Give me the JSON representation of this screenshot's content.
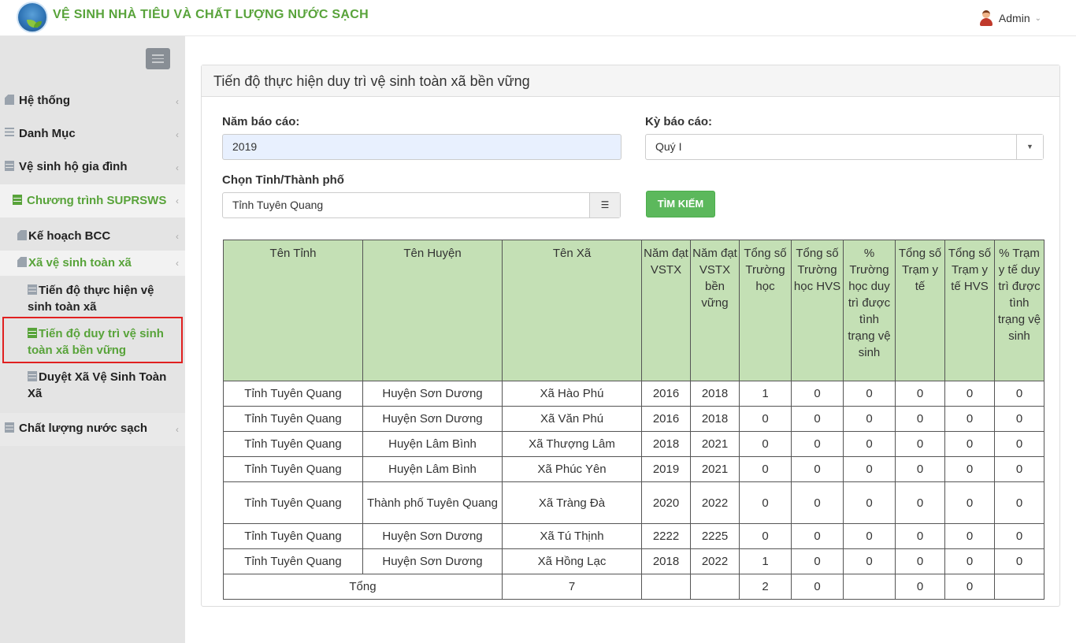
{
  "header": {
    "title": "VỆ SINH NHÀ TIÊU VÀ CHẤT LƯỢNG NƯỚC SẠCH",
    "user": "Admin"
  },
  "sidebar": {
    "items": [
      {
        "label": "Hệ thống",
        "icon": "file-icon"
      },
      {
        "label": "Danh Mục",
        "icon": "list-icon"
      },
      {
        "label": "Vệ sinh hộ gia đình",
        "icon": "table-icon"
      },
      {
        "label": "Chương trình SUPRSWS",
        "icon": "table-icon",
        "active": true
      },
      {
        "label": "Kế hoạch BCC",
        "icon": "file-icon"
      },
      {
        "label": "Xã vệ sinh toàn xã",
        "icon": "file-icon",
        "active": true
      },
      {
        "label": "Tiến độ thực hiện vệ sinh toàn xã",
        "icon": "table-icon"
      },
      {
        "label": "Tiến độ duy trì vệ sinh toàn xã bền vững",
        "icon": "table-icon",
        "selected": true
      },
      {
        "label": "Duyệt Xã Vệ Sinh Toàn Xã",
        "icon": "table-icon"
      },
      {
        "label": "Chất lượng nước sạch",
        "icon": "table-icon"
      }
    ]
  },
  "panel": {
    "title": "Tiến độ thực hiện duy trì vệ sinh toàn xã bền vững"
  },
  "form": {
    "year_label": "Năm báo cáo:",
    "year_value": "2019",
    "period_label": "Kỳ báo cáo:",
    "period_value": "Quý I",
    "province_label": "Chọn Tỉnh/Thành phố",
    "province_value": "Tỉnh Tuyên Quang",
    "search_label": "TÌM KIẾM"
  },
  "table": {
    "headers": [
      "Tên Tỉnh",
      "Tên Huyện",
      "Tên Xã",
      "Năm đạt VSTX",
      "Năm đạt VSTX bền vững",
      "Tổng số Trường học",
      "Tổng số Trường học HVS",
      "% Trường học duy trì được tình trạng vệ sinh",
      "Tổng số Trạm y tế",
      "Tổng số Trạm y tế HVS",
      "% Trạm y tế duy trì được tình trạng vệ sinh"
    ],
    "rows": [
      [
        "Tỉnh Tuyên Quang",
        "Huyện Sơn Dương",
        "Xã Hào Phú",
        "2016",
        "2018",
        "1",
        "0",
        "0",
        "0",
        "0",
        "0"
      ],
      [
        "Tỉnh Tuyên Quang",
        "Huyện Sơn Dương",
        "Xã Văn Phú",
        "2016",
        "2018",
        "0",
        "0",
        "0",
        "0",
        "0",
        "0"
      ],
      [
        "Tỉnh Tuyên Quang",
        "Huyện Lâm Bình",
        "Xã Thượng Lâm",
        "2018",
        "2021",
        "0",
        "0",
        "0",
        "0",
        "0",
        "0"
      ],
      [
        "Tỉnh Tuyên Quang",
        "Huyện Lâm Bình",
        "Xã Phúc Yên",
        "2019",
        "2021",
        "0",
        "0",
        "0",
        "0",
        "0",
        "0"
      ],
      [
        "Tỉnh Tuyên Quang",
        "Thành phố Tuyên Quang",
        "Xã Tràng Đà",
        "2020",
        "2022",
        "0",
        "0",
        "0",
        "0",
        "0",
        "0"
      ],
      [
        "Tỉnh Tuyên Quang",
        "Huyện Sơn Dương",
        "Xã Tú Thịnh",
        "2222",
        "2225",
        "0",
        "0",
        "0",
        "0",
        "0",
        "0"
      ],
      [
        "Tỉnh Tuyên Quang",
        "Huyện Sơn Dương",
        "Xã Hồng Lạc",
        "2018",
        "2022",
        "1",
        "0",
        "0",
        "0",
        "0",
        "0"
      ]
    ],
    "total": {
      "label": "Tổng",
      "xa_count": "7",
      "nam_vstx": "",
      "nam_bv": "",
      "truong": "2",
      "truong_hvs": "0",
      "pct_truong": "",
      "tram": "0",
      "tram_hvs": "0",
      "pct_tram": ""
    }
  },
  "colors": {
    "brand_green": "#58a33a",
    "header_cell_bg": "#c4e0b5",
    "button_green": "#5cb85c",
    "highlight_red": "#e02020"
  }
}
